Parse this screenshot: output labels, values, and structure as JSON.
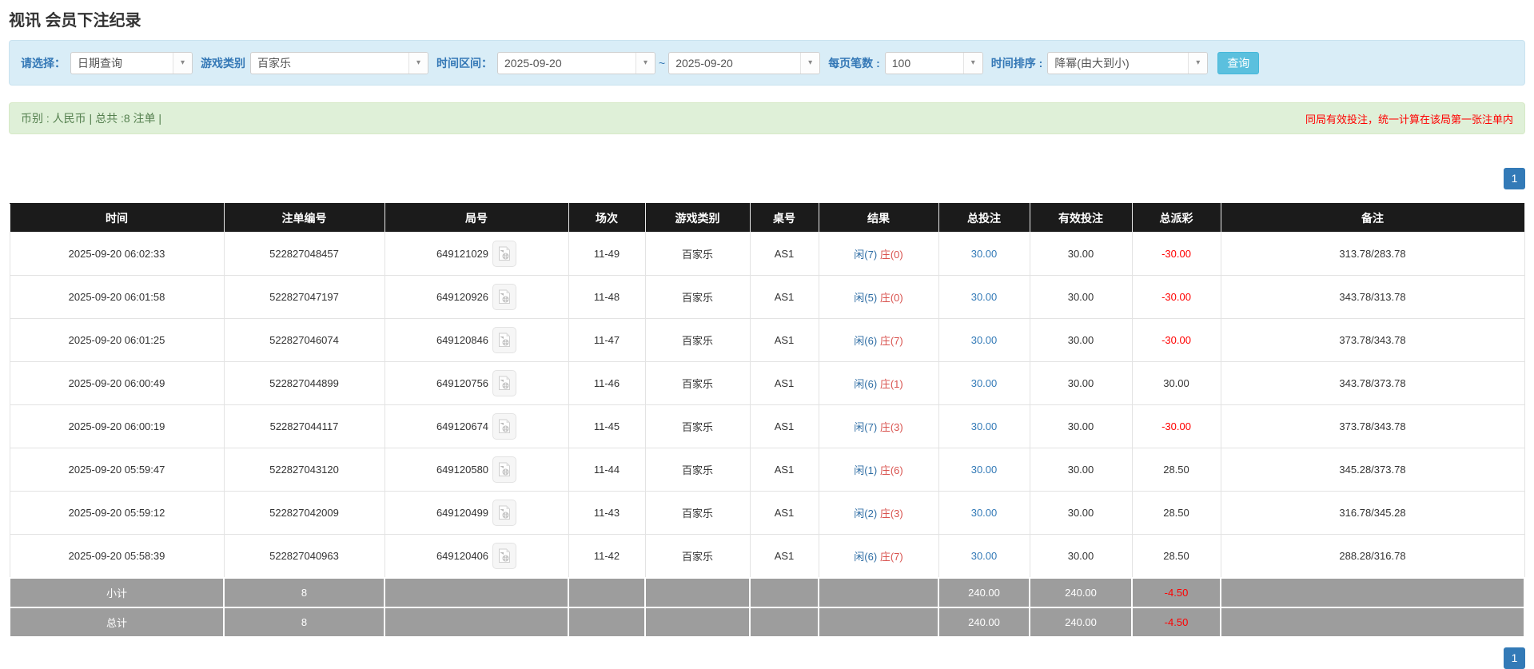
{
  "page": {
    "title": "视讯 会员下注纪录"
  },
  "filters": {
    "query_type_label": "请选择：",
    "query_type_value": "日期查询",
    "game_type_label": "游戏类别",
    "game_type_value": "百家乐",
    "time_range_label": "时间区间：",
    "date_from": "2025-09-20",
    "tilde": "~",
    "date_to": "2025-09-20",
    "page_size_label": "每页笔数 :",
    "page_size_value": "100",
    "time_sort_label": "时间排序 :",
    "time_sort_value": "降幂(由大到小)",
    "search_button": "查询"
  },
  "summary": {
    "left": "币别 : 人民币 | 总共 :8 注单 |",
    "right": "同局有效投注，统一计算在该局第一张注单内"
  },
  "pagination": {
    "page": "1"
  },
  "colors": {
    "accent_info": "#5bc0de",
    "link_blue": "#337ab7",
    "player_blue": "#2e6da4",
    "banker_red": "#d9534f",
    "negative_red": "#ff0000",
    "header_bg": "#1b1b1b",
    "footer_gray": "#9d9d9d",
    "filter_bg": "#d9edf7",
    "summary_bg": "#dff0d8"
  },
  "table": {
    "headers": [
      "时间",
      "注单编号",
      "局号",
      "场次",
      "游戏类别",
      "桌号",
      "结果",
      "总投注",
      "有效投注",
      "总派彩",
      "备注"
    ],
    "rows": [
      {
        "time": "2025-09-20 06:02:33",
        "bet_id": "522827048457",
        "round_id": "649121029",
        "session": "11-49",
        "game": "百家乐",
        "table_no": "AS1",
        "result_player": "闲(7)",
        "result_banker": "庄(0)",
        "total_bet": "30.00",
        "valid_bet": "30.00",
        "payout": "-30.00",
        "remark": "313.78/283.78"
      },
      {
        "time": "2025-09-20 06:01:58",
        "bet_id": "522827047197",
        "round_id": "649120926",
        "session": "11-48",
        "game": "百家乐",
        "table_no": "AS1",
        "result_player": "闲(5)",
        "result_banker": "庄(0)",
        "total_bet": "30.00",
        "valid_bet": "30.00",
        "payout": "-30.00",
        "remark": "343.78/313.78"
      },
      {
        "time": "2025-09-20 06:01:25",
        "bet_id": "522827046074",
        "round_id": "649120846",
        "session": "11-47",
        "game": "百家乐",
        "table_no": "AS1",
        "result_player": "闲(6)",
        "result_banker": "庄(7)",
        "total_bet": "30.00",
        "valid_bet": "30.00",
        "payout": "-30.00",
        "remark": "373.78/343.78"
      },
      {
        "time": "2025-09-20 06:00:49",
        "bet_id": "522827044899",
        "round_id": "649120756",
        "session": "11-46",
        "game": "百家乐",
        "table_no": "AS1",
        "result_player": "闲(6)",
        "result_banker": "庄(1)",
        "total_bet": "30.00",
        "valid_bet": "30.00",
        "payout": "30.00",
        "remark": "343.78/373.78"
      },
      {
        "time": "2025-09-20 06:00:19",
        "bet_id": "522827044117",
        "round_id": "649120674",
        "session": "11-45",
        "game": "百家乐",
        "table_no": "AS1",
        "result_player": "闲(7)",
        "result_banker": "庄(3)",
        "total_bet": "30.00",
        "valid_bet": "30.00",
        "payout": "-30.00",
        "remark": "373.78/343.78"
      },
      {
        "time": "2025-09-20 05:59:47",
        "bet_id": "522827043120",
        "round_id": "649120580",
        "session": "11-44",
        "game": "百家乐",
        "table_no": "AS1",
        "result_player": "闲(1)",
        "result_banker": "庄(6)",
        "total_bet": "30.00",
        "valid_bet": "30.00",
        "payout": "28.50",
        "remark": "345.28/373.78"
      },
      {
        "time": "2025-09-20 05:59:12",
        "bet_id": "522827042009",
        "round_id": "649120499",
        "session": "11-43",
        "game": "百家乐",
        "table_no": "AS1",
        "result_player": "闲(2)",
        "result_banker": "庄(3)",
        "total_bet": "30.00",
        "valid_bet": "30.00",
        "payout": "28.50",
        "remark": "316.78/345.28"
      },
      {
        "time": "2025-09-20 05:58:39",
        "bet_id": "522827040963",
        "round_id": "649120406",
        "session": "11-42",
        "game": "百家乐",
        "table_no": "AS1",
        "result_player": "闲(6)",
        "result_banker": "庄(7)",
        "total_bet": "30.00",
        "valid_bet": "30.00",
        "payout": "28.50",
        "remark": "288.28/316.78"
      }
    ],
    "subtotal": {
      "label": "小计",
      "count": "8",
      "total_bet": "240.00",
      "valid_bet": "240.00",
      "payout": "-4.50"
    },
    "total": {
      "label": "总计",
      "count": "8",
      "total_bet": "240.00",
      "valid_bet": "240.00",
      "payout": "-4.50"
    }
  }
}
